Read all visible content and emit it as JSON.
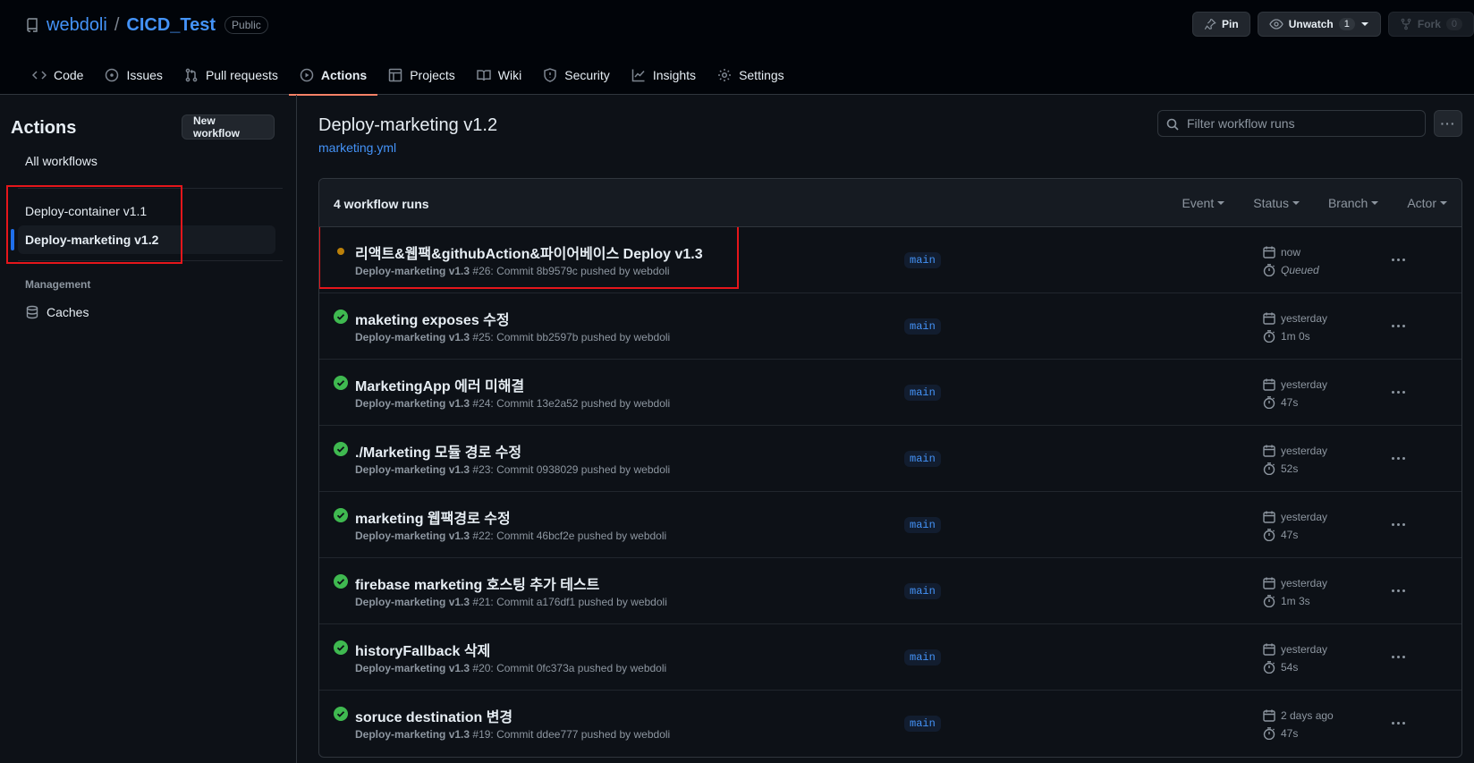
{
  "repo": {
    "owner": "webdoli",
    "separator": "/",
    "name": "CICD_Test",
    "visibility": "Public",
    "pin_label": "Pin",
    "watch_label": "Unwatch",
    "watch_count": "1",
    "fork_label": "Fork",
    "fork_count": "0"
  },
  "tabs": [
    {
      "label": "Code",
      "icon": "code-icon"
    },
    {
      "label": "Issues",
      "icon": "issue-icon"
    },
    {
      "label": "Pull requests",
      "icon": "pull-request-icon"
    },
    {
      "label": "Actions",
      "icon": "play-icon",
      "active": true
    },
    {
      "label": "Projects",
      "icon": "table-icon"
    },
    {
      "label": "Wiki",
      "icon": "book-icon"
    },
    {
      "label": "Security",
      "icon": "shield-icon"
    },
    {
      "label": "Insights",
      "icon": "graph-icon"
    },
    {
      "label": "Settings",
      "icon": "gear-icon"
    }
  ],
  "sidebar": {
    "title": "Actions",
    "new_workflow": "New workflow",
    "all_workflows": "All workflows",
    "workflows": [
      {
        "label": "Deploy-container v1.1"
      },
      {
        "label": "Deploy-marketing v1.2",
        "selected": true
      }
    ],
    "management_heading": "Management",
    "caches": "Caches"
  },
  "main": {
    "title": "Deploy-marketing v1.2",
    "file": "marketing.yml",
    "filter_placeholder": "Filter workflow runs",
    "more_label": "···",
    "runs_count": "4 workflow runs",
    "filters": [
      "Event",
      "Status",
      "Branch",
      "Actor"
    ]
  },
  "runs": [
    {
      "title": "리액트&웹팩&githubAction&파이어베이스 Deploy v1.3",
      "workflow": "Deploy-marketing v1.3",
      "detail": "#26: Commit 8b9579c pushed by webdoli",
      "branch": "main",
      "when": "now",
      "duration": "Queued",
      "status": "queued"
    },
    {
      "title": "maketing exposes 수정",
      "workflow": "Deploy-marketing v1.3",
      "detail": "#25: Commit bb2597b pushed by webdoli",
      "branch": "main",
      "when": "yesterday",
      "duration": "1m 0s",
      "status": "success"
    },
    {
      "title": "MarketingApp 에러 미해결",
      "workflow": "Deploy-marketing v1.3",
      "detail": "#24: Commit 13e2a52 pushed by webdoli",
      "branch": "main",
      "when": "yesterday",
      "duration": "47s",
      "status": "success"
    },
    {
      "title": "./Marketing 모듈 경로 수정",
      "workflow": "Deploy-marketing v1.3",
      "detail": "#23: Commit 0938029 pushed by webdoli",
      "branch": "main",
      "when": "yesterday",
      "duration": "52s",
      "status": "success"
    },
    {
      "title": "marketing 웹팩경로 수정",
      "workflow": "Deploy-marketing v1.3",
      "detail": "#22: Commit 46bcf2e pushed by webdoli",
      "branch": "main",
      "when": "yesterday",
      "duration": "47s",
      "status": "success"
    },
    {
      "title": "firebase marketing 호스팅 추가 테스트",
      "workflow": "Deploy-marketing v1.3",
      "detail": "#21: Commit a176df1 pushed by webdoli",
      "branch": "main",
      "when": "yesterday",
      "duration": "1m 3s",
      "status": "success"
    },
    {
      "title": "historyFallback 삭제",
      "workflow": "Deploy-marketing v1.3",
      "detail": "#20: Commit 0fc373a pushed by webdoli",
      "branch": "main",
      "when": "yesterday",
      "duration": "54s",
      "status": "success"
    },
    {
      "title": "soruce destination 변경",
      "workflow": "Deploy-marketing v1.3",
      "detail": "#19: Commit ddee777 pushed by webdoli",
      "branch": "main",
      "when": "2 days ago",
      "duration": "47s",
      "status": "success"
    }
  ],
  "colors": {
    "background": "#0d1117",
    "link": "#4493f8",
    "success": "#3fb950",
    "queued": "#bb8009",
    "tab_underline": "#f78166",
    "annotation_box": "#e5161b"
  }
}
